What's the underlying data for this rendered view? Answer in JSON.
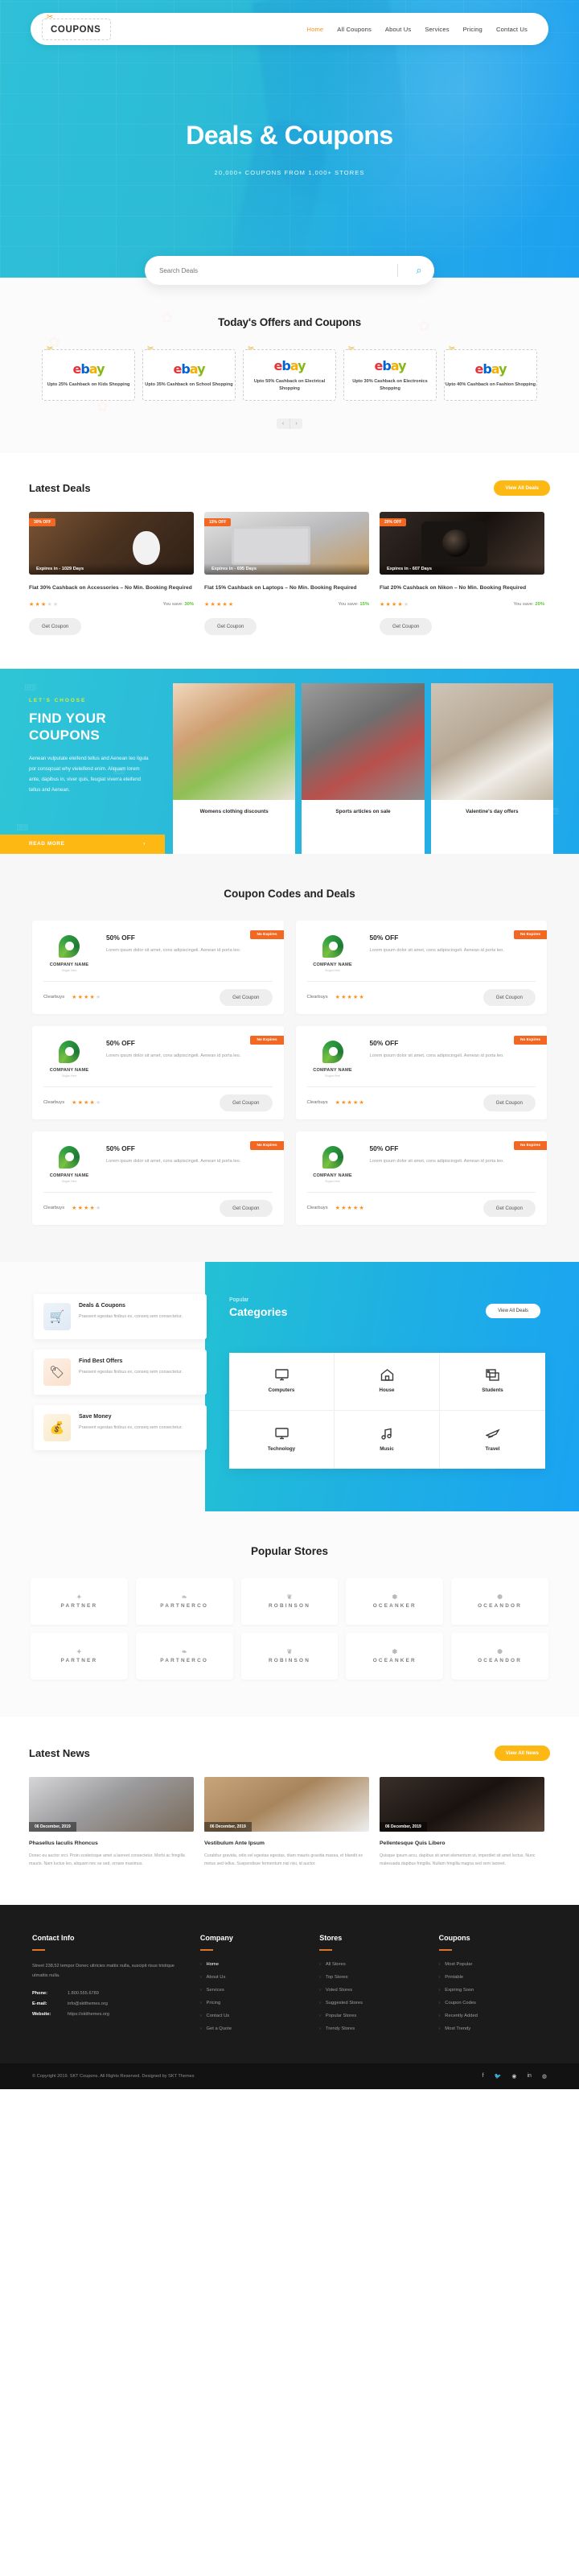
{
  "header": {
    "brand": "COUPONS",
    "brand_icon": "scissors-icon",
    "nav": [
      {
        "label": "Home",
        "active": true
      },
      {
        "label": "All Coupons",
        "active": false
      },
      {
        "label": "About Us",
        "active": false
      },
      {
        "label": "Services",
        "active": false
      },
      {
        "label": "Pricing",
        "active": false
      },
      {
        "label": "Contact Us",
        "active": false
      }
    ]
  },
  "hero": {
    "title": "Deals & Coupons",
    "subtitle": "20,000+ COUPONS FROM 1,000+ STORES"
  },
  "search": {
    "placeholder": "Search Deals",
    "value": "",
    "icon": "search-icon"
  },
  "offers": {
    "title": "Today's Offers and Coupons",
    "cards": [
      {
        "brand": "ebay",
        "text": "Upto 25% Cashback on Kids Shopping"
      },
      {
        "brand": "ebay",
        "text": "Upto 35% Cashback on School Shopping"
      },
      {
        "brand": "ebay",
        "text": "Upto 50% Cashback on Electrical Shopping"
      },
      {
        "brand": "ebay",
        "text": "Upto 30% Cashback on Electronics Shopping"
      },
      {
        "brand": "ebay",
        "text": "Upto 40% Cashback on Fashion Shopping"
      }
    ],
    "prev": "‹",
    "next": "›"
  },
  "latest_deals": {
    "title": "Latest Deals",
    "view_all": "View All Deals",
    "deals": [
      {
        "badge": "30% OFF",
        "expires": "Expires in - 1029 Days",
        "title": "Flat 30% Cashback on Accessories – No Min. Booking Required",
        "stars": 3,
        "save_label": "You save:",
        "save_value": "30%",
        "button": "Get Coupon"
      },
      {
        "badge": "15% OFF",
        "expires": "Expires in - 695 Days",
        "title": "Flat 15% Cashback on Laptops – No Min. Booking Required",
        "stars": 5,
        "save_label": "You save:",
        "save_value": "15%",
        "button": "Get Coupon"
      },
      {
        "badge": "20% OFF",
        "expires": "Expires in - 607 Days",
        "title": "Flat 20% Cashback on Nikon – No Min. Booking Required",
        "stars": 4,
        "save_label": "You save:",
        "save_value": "20%",
        "button": "Get Coupon"
      }
    ]
  },
  "find": {
    "eyebrow": "LET'S CHOOSE",
    "title": "FIND YOUR COUPONS",
    "body": "Aenean vulputate eleifend tellus and Aenean leo ligula por consqouat why vieleifend enim. Aliquam lorem ante, dapibus in, viver quis, feugiat viverra eleifend tellus and Aenean.",
    "read_more": "READ MORE",
    "arrow": "›",
    "cards": [
      {
        "caption": "Womens clothing discounts"
      },
      {
        "caption": "Sports articles on sale"
      },
      {
        "caption": "Valentine's day offers"
      }
    ]
  },
  "coupon_codes": {
    "title": "Coupon Codes and Deals",
    "cards": [
      {
        "company": "COMPANY NAME",
        "slogan": "Slogan Here",
        "offer": "50% OFF",
        "desc": "Lorem ipsum dolor sit amet, cons adipiscingeli. Aenean id porta leo.",
        "badge": "No Expires",
        "store": "Clearbuys",
        "stars": 4,
        "button": "Get Coupon"
      },
      {
        "company": "COMPANY NAME",
        "slogan": "Slogan Here",
        "offer": "50% OFF",
        "desc": "Lorem ipsum dolor sit amet, cons adipiscingeli. Aenean id porta leo.",
        "badge": "No Expires",
        "store": "Clearbuys",
        "stars": 5,
        "button": "Get Coupon"
      },
      {
        "company": "COMPANY NAME",
        "slogan": "Slogan Here",
        "offer": "50% OFF",
        "desc": "Lorem ipsum dolor sit amet, cons adipiscingeli. Aenean id porta leo.",
        "badge": "No Expires",
        "store": "Clearbuys",
        "stars": 4,
        "button": "Get Coupon"
      },
      {
        "company": "COMPANY NAME",
        "slogan": "Slogan Here",
        "offer": "50% OFF",
        "desc": "Lorem ipsum dolor sit amet, cons adipiscingeli. Aenean id porta leo.",
        "badge": "No Expires",
        "store": "Clearbuys",
        "stars": 5,
        "button": "Get Coupon"
      },
      {
        "company": "COMPANY NAME",
        "slogan": "Slogan Here",
        "offer": "50% OFF",
        "desc": "Lorem ipsum dolor sit amet, cons adipiscingeli. Aenean id porta leo.",
        "badge": "No Expires",
        "store": "Clearbuys",
        "stars": 4,
        "button": "Get Coupon"
      },
      {
        "company": "COMPANY NAME",
        "slogan": "Slogan Here",
        "offer": "50% OFF",
        "desc": "Lorem ipsum dolor sit amet, cons adipiscingeli. Aenean id porta leo.",
        "badge": "No Expires",
        "store": "Clearbuys",
        "stars": 5,
        "button": "Get Coupon"
      }
    ]
  },
  "features": [
    {
      "title": "Deals & Coupons",
      "desc": "Praesent egestas finibus ex, conseq sem consectetur.",
      "icon": "shopping-cart-icon"
    },
    {
      "title": "Find Best Offers",
      "desc": "Praesent egestas finibus ex, conseq sem consectetur.",
      "icon": "price-tag-icon"
    },
    {
      "title": "Save Money",
      "desc": "Praesent egestas finibus ex, conseq sem consectetur.",
      "icon": "money-icon"
    }
  ],
  "categories": {
    "eyebrow": "Popular",
    "title": "Categories",
    "view_all": "View All Deals",
    "items": [
      {
        "label": "Computers",
        "icon": "monitor-icon"
      },
      {
        "label": "House",
        "icon": "home-icon"
      },
      {
        "label": "Students",
        "icon": "photos-icon"
      },
      {
        "label": "Technology",
        "icon": "monitor-icon"
      },
      {
        "label": "Music",
        "icon": "music-note-icon"
      },
      {
        "label": "Travel",
        "icon": "airplane-icon"
      }
    ]
  },
  "popular_stores": {
    "title": "Popular Stores",
    "logos": [
      "PARTNER",
      "PARTNERCO",
      "ROBINSON",
      "OCEANKER",
      "OCEANDOR",
      "PARTNER",
      "PARTNERCO",
      "ROBINSON",
      "OCEANKER",
      "OCEANDOR"
    ]
  },
  "latest_news": {
    "title": "Latest News",
    "view_all": "View All News",
    "posts": [
      {
        "date": "06 December, 2019",
        "title": "Phasellus Iaculis Rhoncus",
        "excerpt": "Donec eu auctor orci. Proin scelerisque amet a laoreet consectetur. Morbi ac fringilla mauris. Nam luctus leo, aliquam nec se sed, ornare maximus."
      },
      {
        "date": "06 December, 2019",
        "title": "Vestibulum Ante Ipsum",
        "excerpt": "Curabitur gravida, odio vel egestas egestas, diam mauris gravida massa, et blandit ex metus sed tellus. Suspendisse fermentum nisl nisi, id auctor."
      },
      {
        "date": "06 December, 2019",
        "title": "Pellentesque Quis Libero",
        "excerpt": "Quisque ipsum arcu, dapibus sit amet elementum ut, imperdiet sit amet lectus. Nunc malesuada dapibus fringilla. Nullam fringilla magna sed sem laoreet."
      }
    ]
  },
  "footer": {
    "columns": [
      {
        "title": "Contact Info",
        "address": "Street 238,52 tempor Donec ultricies mattis nulla, suscipit risus tristique utmattis nulla.",
        "contacts": [
          {
            "label": "Phone:",
            "value": "1.800.555.6789"
          },
          {
            "label": "E-mail:",
            "value": "info@sktthemes.org"
          },
          {
            "label": "Website:",
            "value": "https://sktthemes.org"
          }
        ]
      },
      {
        "title": "Company",
        "links": [
          {
            "label": "Home",
            "active": true
          },
          {
            "label": "About Us",
            "active": false
          },
          {
            "label": "Services",
            "active": false
          },
          {
            "label": "Pricing",
            "active": false
          },
          {
            "label": "Contact Us",
            "active": false
          },
          {
            "label": "Get a Quote",
            "active": false
          }
        ]
      },
      {
        "title": "Stores",
        "links": [
          {
            "label": "All Stores",
            "active": false
          },
          {
            "label": "Top Stores",
            "active": false
          },
          {
            "label": "Voted Stores",
            "active": false
          },
          {
            "label": "Suggested Stores",
            "active": false
          },
          {
            "label": "Popular Stores",
            "active": false
          },
          {
            "label": "Trendy Stores",
            "active": false
          }
        ]
      },
      {
        "title": "Coupons",
        "links": [
          {
            "label": "Most Popular",
            "active": false
          },
          {
            "label": "Printable",
            "active": false
          },
          {
            "label": "Expiring Soon",
            "active": false
          },
          {
            "label": "Coupon Codes",
            "active": false
          },
          {
            "label": "Recently Added",
            "active": false
          },
          {
            "label": "Most Trendy",
            "active": false
          }
        ]
      }
    ],
    "copyright": "© Copyright 2019. SKT Coupons. All Rights Reserved. Designed by SKT Themes",
    "socials": [
      "facebook-icon",
      "twitter-icon",
      "instagram-icon",
      "linkedin-icon",
      "pinterest-icon"
    ]
  },
  "colors": {
    "accent_orange": "#f7941e",
    "accent_yellow": "#fdb813",
    "brand_blue": "#23b5e0",
    "badge_orange": "#f26722",
    "save_green": "#5bc236",
    "lime": "#d4ef3a"
  }
}
